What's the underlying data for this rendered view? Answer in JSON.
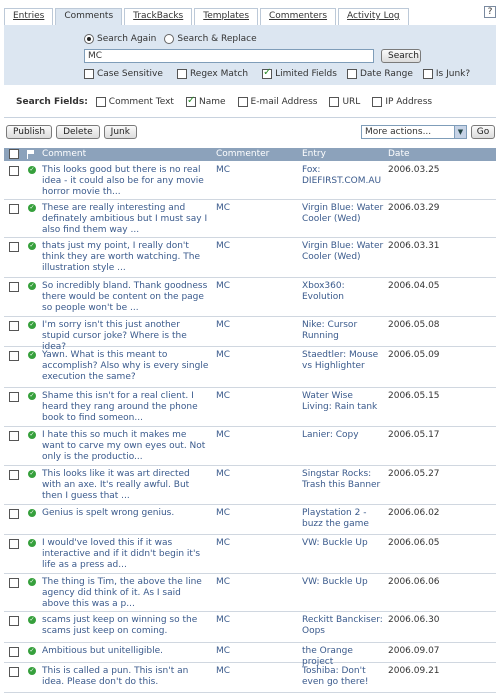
{
  "tabs": [
    "Entries",
    "Comments",
    "TrackBacks",
    "Templates",
    "Commenters",
    "Activity Log"
  ],
  "help": "?",
  "search": {
    "mode_search": "Search Again",
    "mode_replace": "Search & Replace",
    "query": "MC",
    "button": "Search",
    "options": [
      {
        "label": "Case Sensitive",
        "checked": false
      },
      {
        "label": "Regex Match",
        "checked": false
      },
      {
        "label": "Limited Fields",
        "checked": true
      },
      {
        "label": "Date Range",
        "checked": false
      },
      {
        "label": "Is Junk?",
        "checked": false
      }
    ]
  },
  "search_fields": {
    "title": "Search Fields:",
    "fields": [
      {
        "label": "Comment Text",
        "checked": false
      },
      {
        "label": "Name",
        "checked": true
      },
      {
        "label": "E-mail Address",
        "checked": false
      },
      {
        "label": "URL",
        "checked": false
      },
      {
        "label": "IP Address",
        "checked": false
      }
    ]
  },
  "actions": {
    "publish": "Publish",
    "delete": "Delete",
    "junk": "Junk",
    "more": "More actions...",
    "go": "Go"
  },
  "table": {
    "headers": {
      "comment": "Comment",
      "commenter": "Commenter",
      "entry": "Entry",
      "date": "Date"
    },
    "rows": [
      {
        "comment": "This looks good but there is no real idea - it could also be for any movie horror movie th...",
        "commenter": "MC",
        "entry": "Fox: DIEFIRST.COM.AU",
        "date": "2006.03.25"
      },
      {
        "comment": "These are really interesting and definately ambitious but I must say I also find them way ...",
        "commenter": "MC",
        "entry": "Virgin Blue: Water Cooler (Wed)",
        "date": "2006.03.29"
      },
      {
        "comment": "thats just my point, I really don't think they are worth watching. The illustration style ...",
        "commenter": "MC",
        "entry": "Virgin Blue: Water Cooler (Wed)",
        "date": "2006.03.31"
      },
      {
        "comment": "So incredibly bland. Thank goodness there would be content on the page so people won't be ...",
        "commenter": "MC",
        "entry": "Xbox360: Evolution",
        "date": "2006.04.05"
      },
      {
        "comment": "I'm sorry isn't this just another stupid cursor joke? Where is the idea?",
        "commenter": "MC",
        "entry": "Nike: Cursor Running",
        "date": "2006.05.08"
      },
      {
        "comment": "Yawn. What is this meant to accomplish? Also why is every single execution the same?",
        "commenter": "MC",
        "entry": "Staedtler: Mouse vs Highlighter",
        "date": "2006.05.09"
      },
      {
        "comment": "Shame this isn't for a real client. I heard they rang around the phone book to find someon...",
        "commenter": "MC",
        "entry": "Water Wise Living: Rain tank",
        "date": "2006.05.15"
      },
      {
        "comment": "I hate this so much it makes me want to carve my own eyes out. Not only is the productio...",
        "commenter": "MC",
        "entry": "Lanier: Copy",
        "date": "2006.05.17"
      },
      {
        "comment": "This looks like it was art directed with an axe. It's really awful. But then I guess that ...",
        "commenter": "MC",
        "entry": "Singstar Rocks: Trash this Banner",
        "date": "2006.05.27"
      },
      {
        "comment": "Genius is spelt wrong genius.",
        "commenter": "MC",
        "entry": "Playstation 2 - buzz the game",
        "date": "2006.06.02"
      },
      {
        "comment": "I would've loved this if it was interactive and if it didn't begin it's life as a press ad...",
        "commenter": "MC",
        "entry": "VW: Buckle Up",
        "date": "2006.06.05"
      },
      {
        "comment": "The thing is Tim, the above the line agency did think of it. As I said above this was a p...",
        "commenter": "MC",
        "entry": "VW: Buckle Up",
        "date": "2006.06.06"
      },
      {
        "comment": "scams just keep on winning so the scams just keep on coming.",
        "commenter": "MC",
        "entry": "Reckitt Banckiser: Oops",
        "date": "2006.06.30"
      },
      {
        "comment": "Ambitious but unitelligible.",
        "commenter": "MC",
        "entry": "the Orange project",
        "date": "2006.09.07"
      },
      {
        "comment": "This is called a pun. This isn't an idea. Please don't do this.",
        "commenter": "MC",
        "entry": "Toshiba: Don't even go there!",
        "date": "2006.09.21"
      }
    ]
  }
}
